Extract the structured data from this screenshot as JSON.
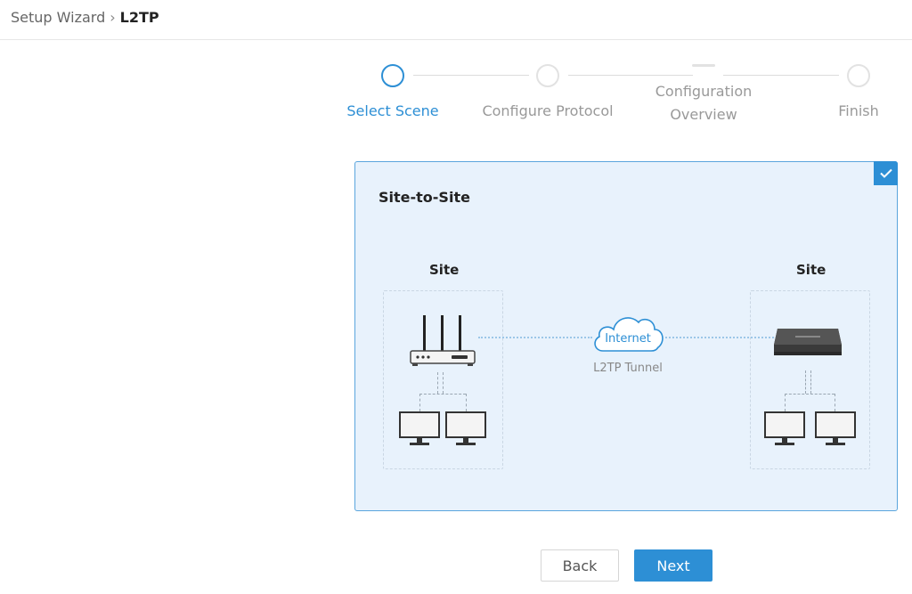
{
  "breadcrumb": {
    "parent": "Setup Wizard",
    "separator": "›",
    "current": "L2TP"
  },
  "steps": [
    {
      "label": "Select Scene",
      "state": "active"
    },
    {
      "label": "Configure Protocol",
      "state": "pending"
    },
    {
      "label_line1": "Configuration",
      "label_line2": "Overview",
      "state": "pending"
    },
    {
      "label": "Finish",
      "state": "pending"
    }
  ],
  "scene": {
    "title": "Site-to-Site",
    "selected": true,
    "left_site_label": "Site",
    "right_site_label": "Site",
    "cloud_label": "Internet",
    "tunnel_label": "L2TP Tunnel"
  },
  "buttons": {
    "back": "Back",
    "next": "Next"
  },
  "colors": {
    "accent": "#2d8fd5",
    "card_bg": "#e8f2fc",
    "card_border": "#5aa5dd"
  }
}
